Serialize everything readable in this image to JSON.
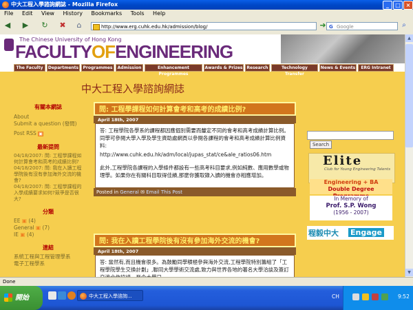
{
  "window": {
    "title": "中大工程入學諮詢網誌 - Mozilla Firefox",
    "buttons": {
      "minimize": "_",
      "maximize": "□",
      "close": "×"
    }
  },
  "menubar": [
    "File",
    "Edit",
    "View",
    "History",
    "Bookmarks",
    "Tools",
    "Help"
  ],
  "toolbar": {
    "url": "http://www.erg.cuhk.edu.hk/admission/blog/",
    "search_placeholder": "Google"
  },
  "banner": {
    "university": "The Chinese University of Hong Kong",
    "faculty_a": "FACULTY",
    "faculty_b": "OF",
    "faculty_c": "ENGINEERING"
  },
  "nav": [
    "The Faculty",
    "Departments",
    "Programmes",
    "Admission",
    "Enhancement Programmes",
    "Awards & Prizes",
    "Research",
    "Technology Transfer",
    "News & Events",
    "ERG Intranet"
  ],
  "site_title": "中大工程入學諮詢網誌",
  "sidebar": {
    "about_head": "有關本網誌",
    "about_links": [
      "About",
      "Submit a question (發問)",
      "Post RSS"
    ],
    "recent_head": "最新提問",
    "recent_items": [
      "04/18/2007: 問: 工程學課程如何計算會考和高考的成績比例?",
      "04/18/2007: 問: 我在入讀工程學院後有沒有參加海外交流的機會?",
      "04/18/2007: 問: 工程學課程的入學成績要求如何?競爭是否很大?"
    ],
    "cat_head": "分類",
    "cats": [
      {
        "name": "EE",
        "count": "(4)"
      },
      {
        "name": "General",
        "count": "(7)"
      },
      {
        "name": "IE",
        "count": "(4)"
      }
    ],
    "links_head": "連結",
    "links": [
      "系統工程與工程管理學系",
      "電子工程學系"
    ]
  },
  "posts": [
    {
      "title": "問: 工程學課程如何計算會考和高考的成績比例?",
      "date": "April 18th, 2007",
      "body1": "答: 工程學院各學系的課程都因應個別需要而釐定不同的會考和高考成績計算比例。同學可參閱大學入學及學生資助處網頁以參閱各課程的會考和高考成績計算比例資料:",
      "link": "http://www.cuhk.edu.hk/adm/local/jupas_stat/ce&ale_ratios06.htm",
      "body2": "此外,工程學院各課程的入學條件都設有一些高考科目要求,例如純數、應用數學或物理學。如果你在有關科目取得佳績,那麼你獲取錄入讀的機會亦相應增加。",
      "foot_posted": "Posted in",
      "foot_cat": "General",
      "foot_email": "Email This Post"
    },
    {
      "title": "問: 我在入讀工程學院後有沒有參加海外交流的機會?",
      "date": "April 18th, 2007",
      "body1": "答: 當然有,而且機會很多。為鼓勵同學積極參與海外交流,工程學院特別籌組了「工程學院學生交換計劃」,聯同大學學術交流處,致力與世界各地的著名大學洽談及簽訂交流合作協議。至今大學已"
    }
  ],
  "right": {
    "search_button": "Search",
    "elite_title": "Elite",
    "elite_sub": "Club for Young Engineering Talents",
    "eng_line1": "Engineering + BA",
    "eng_line2": "Double Degree Programme",
    "mem_line1": "In Memory of",
    "mem_line2": "Prof. S.P. Wong",
    "mem_line3": "(1956 - 2007)",
    "engage_zh": "程毅中大",
    "engage_en": "Engage"
  },
  "status": "Done",
  "taskbar": {
    "start": "開始",
    "task_item": "中大工程入學諮詢...",
    "lang": "CH",
    "clock": "9:52"
  }
}
